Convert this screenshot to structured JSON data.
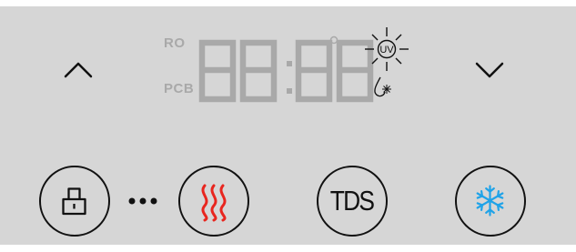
{
  "panel": {
    "display": {
      "mode_labels": [
        "RO",
        "PCB"
      ],
      "digits_text": "88:88",
      "indicators": [
        "degree-indicator",
        "uv-lamp-icon",
        "water-drop-icon"
      ],
      "uv_label": "UV"
    },
    "buttons": {
      "up": {
        "icon": "chevron-up-icon"
      },
      "down": {
        "icon": "chevron-down-icon"
      },
      "lock": {
        "icon": "child-lock-icon"
      },
      "heat": {
        "icon": "heat-waves-icon",
        "color": "#e8261f"
      },
      "tds": {
        "label": "TDS"
      },
      "cold": {
        "icon": "snowflake-icon",
        "color": "#1fa3e8"
      }
    },
    "colors": {
      "background": "#d6d6d6",
      "segment_inactive": "#a9a9a9",
      "outline": "#111111"
    }
  }
}
